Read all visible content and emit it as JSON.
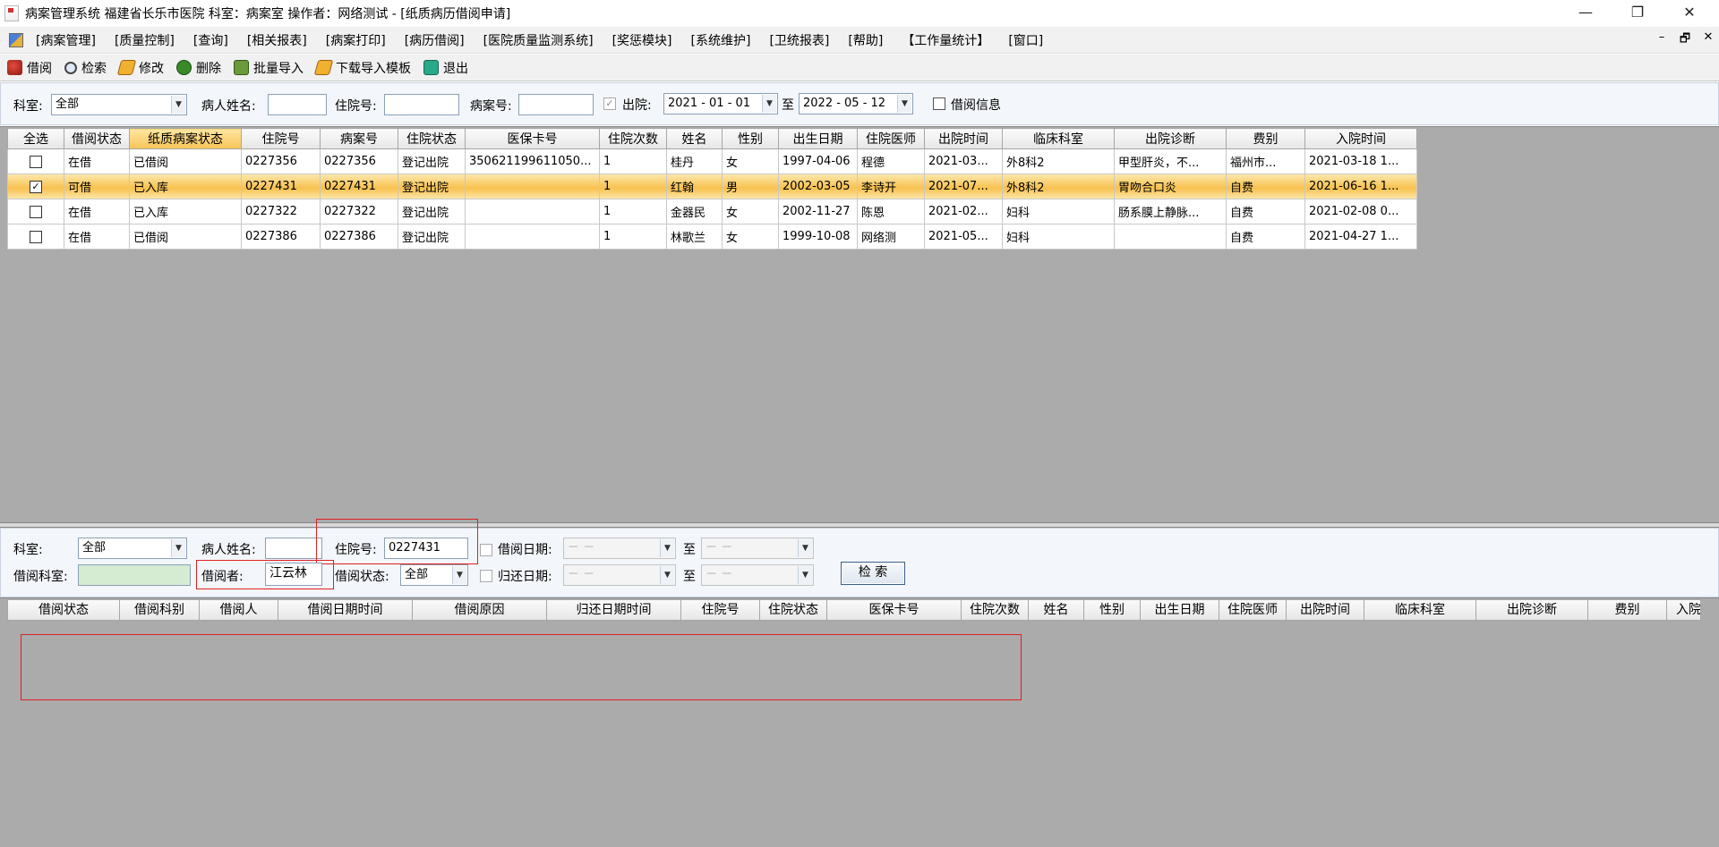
{
  "window": {
    "title": "病案管理系统  福建省长乐市医院  科室：病案室 操作者：网络测试 - [纸质病历借阅申请]",
    "minimize": "—",
    "restore": "❐",
    "close": "✕"
  },
  "menu": {
    "items": [
      "[病案管理]",
      "[质量控制]",
      "[查询]",
      "[相关报表]",
      "[病案打印]",
      "[病历借阅]",
      "[医院质量监测系统]",
      "[奖惩模块]",
      "[系统维护]",
      "[卫统报表]",
      "[帮助]",
      "【工作量统计】",
      "[窗口]"
    ],
    "mdi_min": "–",
    "mdi_restore": "🗗",
    "mdi_close": "✕"
  },
  "toolbar": {
    "borrow": "借阅",
    "search": "检索",
    "edit": "修改",
    "delete": "删除",
    "batch_import": "批量导入",
    "download_template": "下载导入模板",
    "exit": "退出"
  },
  "filter": {
    "dept_label": "科室:",
    "dept_value": "全部",
    "patient_name_label": "病人姓名:",
    "patient_name_value": "",
    "admission_no_label": "住院号:",
    "admission_no_value": "",
    "case_no_label": "病案号:",
    "case_no_value": "",
    "discharge_checked": "✓",
    "discharge_label": "出院:",
    "date_from": "2021 - 01 - 01",
    "to_label": "至",
    "date_to": "2022 - 05 - 12",
    "borrow_info_label": "借阅信息"
  },
  "grid1": {
    "columns": [
      "全选",
      "借阅状态",
      "纸质病案状态",
      "住院号",
      "病案号",
      "住院状态",
      "医保卡号",
      "住院次数",
      "姓名",
      "性别",
      "出生日期",
      "住院医师",
      "出院时间",
      "临床科室",
      "出院诊断",
      "费别",
      "入院时间"
    ],
    "rows": [
      {
        "checked": "",
        "cells": [
          "在借",
          "已借阅",
          "0227356",
          "0227356",
          "登记出院",
          "350621199611050...",
          "1",
          "桂丹",
          "女",
          "1997-04-06",
          "程德",
          "2021-03...",
          "外8科2",
          "甲型肝炎，不...",
          "福州市...",
          "2021-03-18 1..."
        ]
      },
      {
        "checked": "✓",
        "cells": [
          "可借",
          "已入库",
          "0227431",
          "0227431",
          "登记出院",
          "",
          "1",
          "红翰",
          "男",
          "2002-03-05",
          "李诗开",
          "2021-07...",
          "外8科2",
          "胃吻合口炎",
          "自费",
          "2021-06-16 1..."
        ]
      },
      {
        "checked": "",
        "cells": [
          "在借",
          "已入库",
          "0227322",
          "0227322",
          "登记出院",
          "",
          "1",
          "金器民",
          "女",
          "2002-11-27",
          "陈恩",
          "2021-02...",
          "妇科",
          "肠系膜上静脉...",
          "自费",
          "2021-02-08 0..."
        ]
      },
      {
        "checked": "",
        "cells": [
          "在借",
          "已借阅",
          "0227386",
          "0227386",
          "登记出院",
          "",
          "1",
          "林歌兰",
          "女",
          "1999-10-08",
          "网络测",
          "2021-05...",
          "妇科",
          "",
          "自费",
          "2021-04-27 1..."
        ]
      }
    ]
  },
  "filter2": {
    "dept_label": "科室:",
    "dept_value": "全部",
    "patient_name_label": "病人姓名:",
    "patient_name_value": "",
    "admission_no_label": "住院号:",
    "admission_no_value": "0227431",
    "borrow_date_label": "借阅日期:",
    "borrow_date_from": "－  －",
    "to_label": "至",
    "borrow_date_to": "－  －",
    "borrow_dept_label": "借阅科室:",
    "borrow_dept_value": "",
    "borrower_label": "借阅者:",
    "borrower_value": "江云林",
    "borrow_status_label": "借阅状态:",
    "borrow_status_value": "全部",
    "return_date_label": "归还日期:",
    "return_date_from": "－  －",
    "return_date_to": "－  －",
    "search_button": "检  索"
  },
  "grid2": {
    "columns": [
      "借阅状态",
      "借阅科别",
      "借阅人",
      "借阅日期时间",
      "借阅原因",
      "归还日期时间",
      "住院号",
      "住院状态",
      "医保卡号",
      "住院次数",
      "姓名",
      "性别",
      "出生日期",
      "住院医师",
      "出院时间",
      "临床科室",
      "出院诊断",
      "费别",
      "入院"
    ]
  }
}
